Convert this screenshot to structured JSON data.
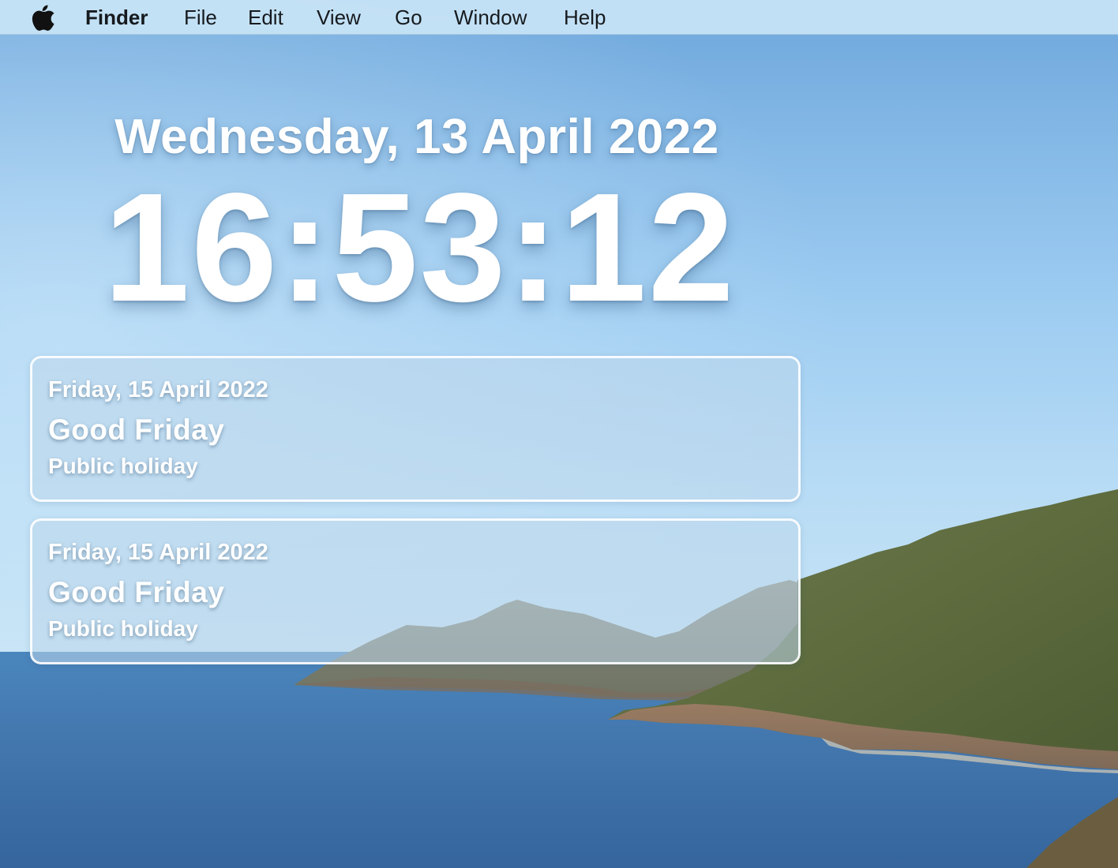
{
  "menubar": {
    "apple_icon": "apple-icon",
    "app_name": "Finder",
    "items": [
      "File",
      "Edit",
      "View",
      "Go",
      "Window",
      "Help"
    ]
  },
  "clock": {
    "date": "Wednesday, 13 April 2022",
    "time": "16:53:12"
  },
  "events": [
    {
      "date": "Friday, 15 April 2022",
      "title": "Good Friday",
      "type": "Public holiday"
    },
    {
      "date": "Friday, 15 April 2022",
      "title": "Good Friday",
      "type": "Public holiday"
    }
  ],
  "colors": {
    "menubar": "#c8e4f6",
    "sky": "#8fc2ec",
    "sea": "#3f73ab",
    "text": "#ffffff"
  }
}
